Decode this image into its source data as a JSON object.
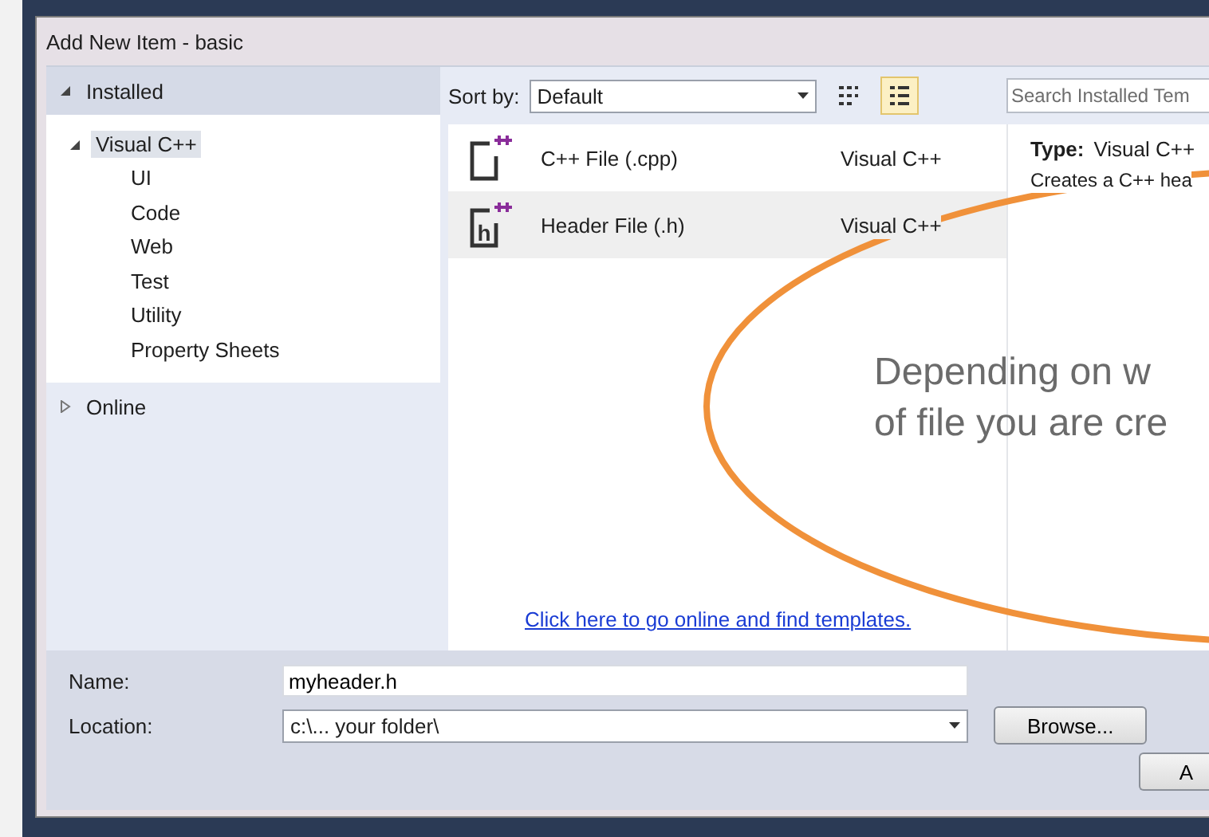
{
  "window": {
    "title": "Add New Item - basic"
  },
  "sidebar": {
    "sections": [
      {
        "label": "Installed",
        "expanded": true,
        "children": [
          {
            "label": "Visual C++",
            "selected": true,
            "expanded": true,
            "children": [
              {
                "label": "UI",
                "selected": false
              },
              {
                "label": "Code",
                "selected": false
              },
              {
                "label": "Web",
                "selected": false
              },
              {
                "label": "Test",
                "selected": false
              },
              {
                "label": "Utility",
                "selected": false
              },
              {
                "label": "Property Sheets",
                "selected": false
              }
            ]
          }
        ]
      },
      {
        "label": "Online",
        "expanded": false
      }
    ]
  },
  "toolbar": {
    "sort_label": "Sort by:",
    "sort_value": "Default",
    "views": [
      {
        "kind": "small-icons",
        "selected": false
      },
      {
        "kind": "details",
        "selected": true
      }
    ],
    "search": {
      "placeholder": "Search Installed Tem"
    }
  },
  "templates": [
    {
      "name": "C++ File (.cpp)",
      "kind": "source",
      "category": "Visual C++",
      "selected": false
    },
    {
      "name": "Header File (.h)",
      "kind": "header",
      "glyph": "h",
      "category": "Visual C++",
      "selected": true
    }
  ],
  "online_link": "Click here to go online and find templates.",
  "details": {
    "type_label": "Type:",
    "type_value": "Visual C++",
    "description": "Creates a C++ hea"
  },
  "form": {
    "name_label": "Name:",
    "name_value": "myheader.h",
    "location_label": "Location:",
    "location_value": "c:\\... your folder\\",
    "browse_button": "Browse...",
    "add_button": "A"
  },
  "callout": {
    "lines": [
      "Depending on w",
      "of file you are cre"
    ]
  }
}
